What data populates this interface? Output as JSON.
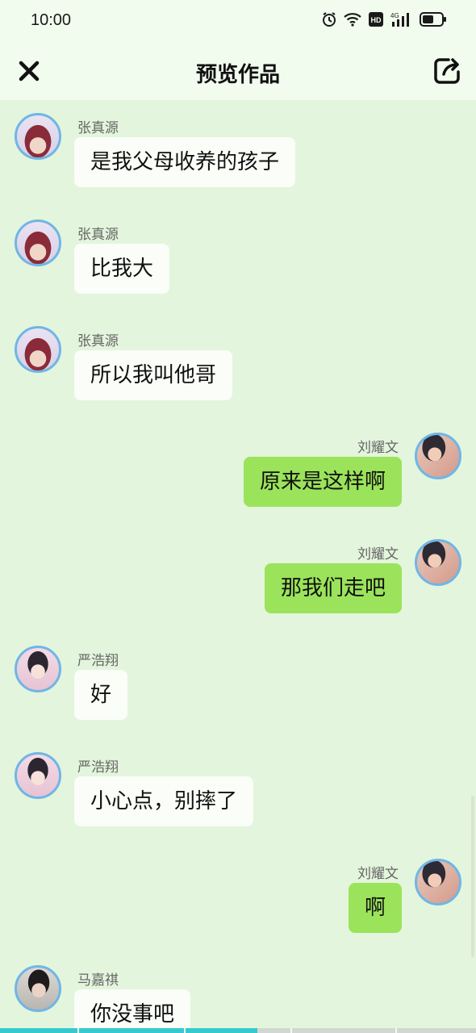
{
  "status_bar": {
    "time": "10:00",
    "icons": [
      "alarm-icon",
      "wifi-icon",
      "hd-icon",
      "signal-4g-icon",
      "battery-icon"
    ],
    "network": "4G",
    "hd": "HD"
  },
  "header": {
    "title": "预览作品",
    "close_icon": "close-icon",
    "share_icon": "share-icon"
  },
  "messages": [
    {
      "side": "left",
      "sender": "张真源",
      "text": "是我父母收养的孩子",
      "avatar": "zhang"
    },
    {
      "side": "left",
      "sender": "张真源",
      "text": "比我大",
      "avatar": "zhang"
    },
    {
      "side": "left",
      "sender": "张真源",
      "text": "所以我叫他哥",
      "avatar": "zhang"
    },
    {
      "side": "right",
      "sender": "刘耀文",
      "text": "原来是这样啊",
      "avatar": "liu"
    },
    {
      "side": "right",
      "sender": "刘耀文",
      "text": "那我们走吧",
      "avatar": "liu"
    },
    {
      "side": "left",
      "sender": "严浩翔",
      "text": "好",
      "avatar": "yan"
    },
    {
      "side": "left",
      "sender": "严浩翔",
      "text": "小心点，别摔了",
      "avatar": "yan"
    },
    {
      "side": "right",
      "sender": "刘耀文",
      "text": "啊",
      "avatar": "liu"
    },
    {
      "side": "left",
      "sender": "马嘉祺",
      "text": "你没事吧",
      "avatar": "ma"
    }
  ],
  "playback": {
    "progress_fraction": 0.54
  },
  "colors": {
    "background": "#e3f5dc",
    "header": "#f1fcee",
    "bubble_right": "#9be35a",
    "bubble_left": "#fafdf8",
    "avatar_ring": "#6fb6e6",
    "progress": "#36c9cf"
  }
}
